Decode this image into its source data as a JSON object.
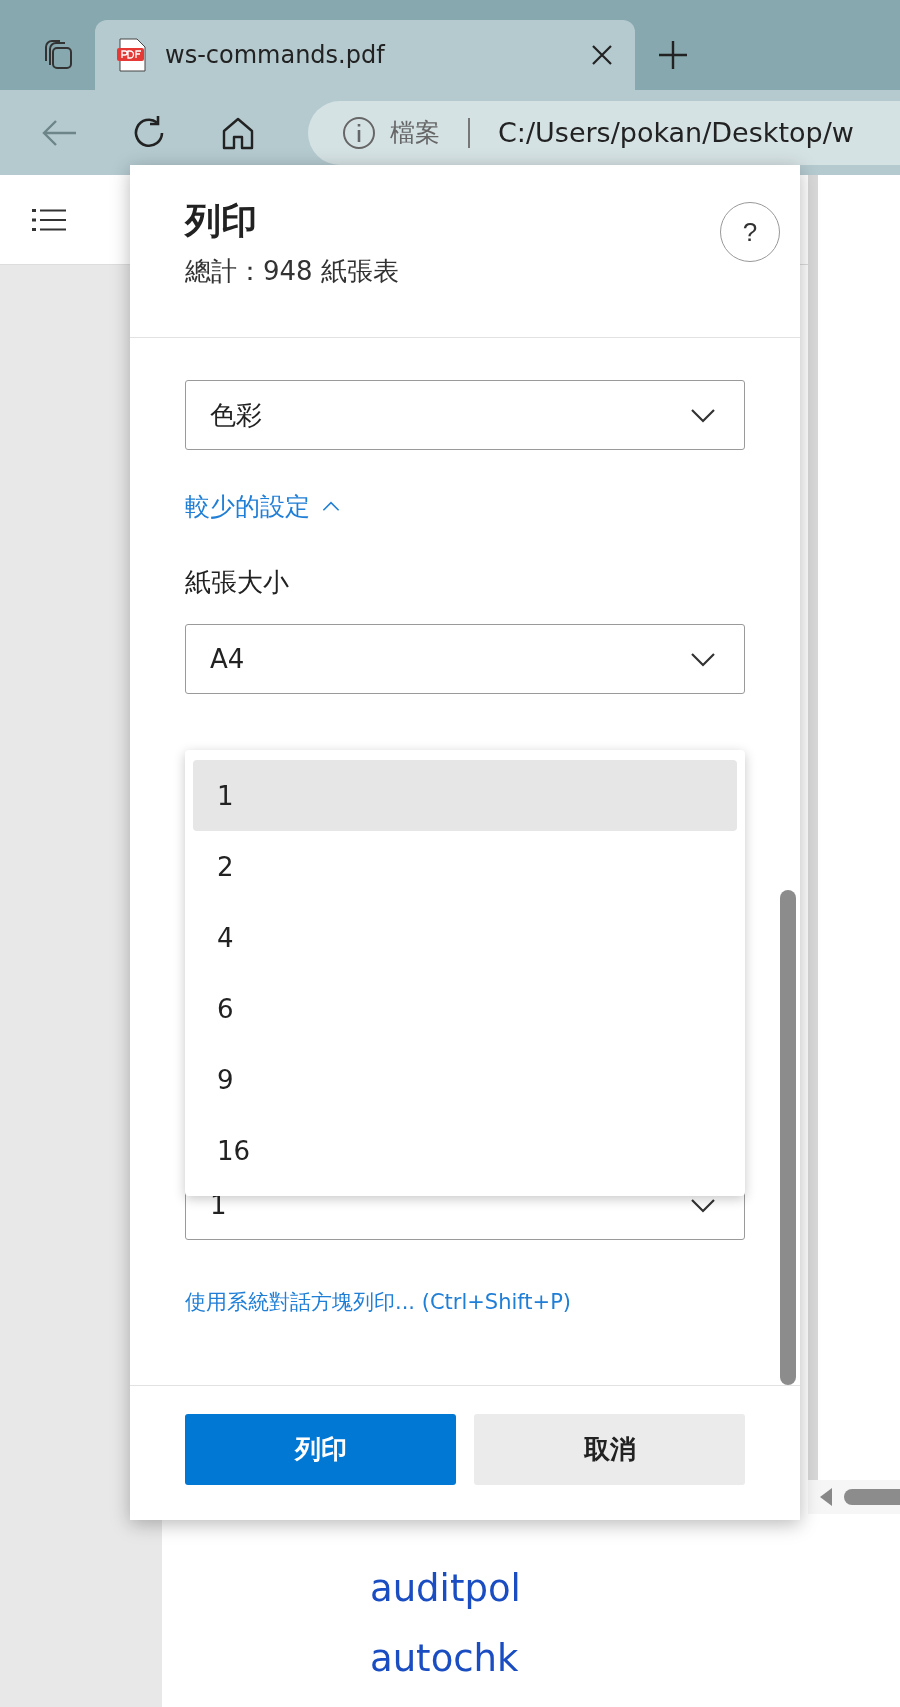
{
  "browser": {
    "tabs": [
      {
        "title": "ws-commands.pdf",
        "selected": true
      }
    ],
    "address": {
      "scheme_label": "檔案",
      "url": "C:/Users/pokan/Desktop/w"
    }
  },
  "print_dialog": {
    "title": "列印",
    "summary": "總計：948 紙張表",
    "help_label": "?",
    "color_select": {
      "value": "色彩"
    },
    "fewer_settings_link": "較少的設定",
    "paper_size": {
      "label": "紙張大小",
      "value": "A4"
    },
    "pages_per_sheet": {
      "value": "1",
      "expanded": true,
      "options": [
        {
          "label": "1",
          "selected": true
        },
        {
          "label": "2",
          "selected": false
        },
        {
          "label": "4",
          "selected": false
        },
        {
          "label": "6",
          "selected": false
        },
        {
          "label": "9",
          "selected": false
        },
        {
          "label": "16",
          "selected": false
        }
      ]
    },
    "system_dialog_link": "使用系統對話方塊列印... (Ctrl+Shift+P)",
    "buttons": [
      {
        "label": "列印",
        "kind": "primary"
      },
      {
        "label": "取消",
        "kind": "secondary"
      }
    ]
  },
  "document": {
    "links": [
      "auditpol",
      "autochk"
    ]
  }
}
